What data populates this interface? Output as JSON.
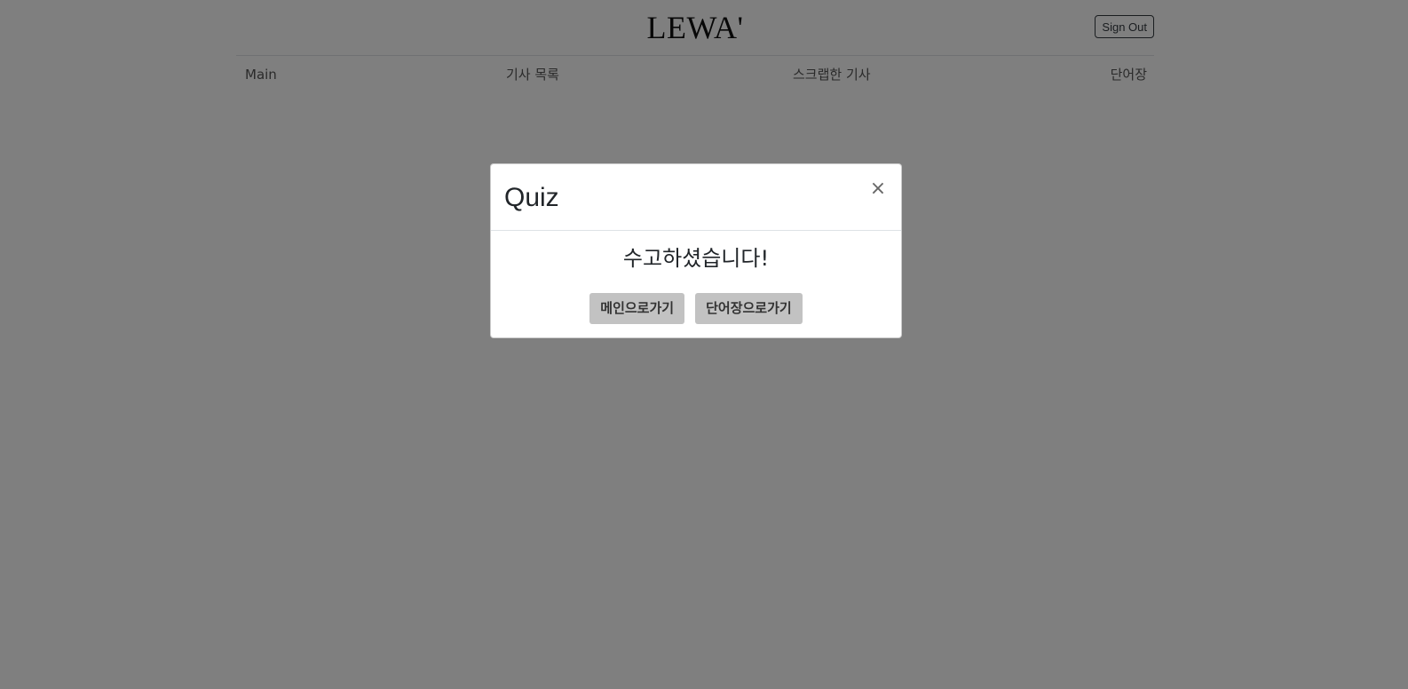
{
  "header": {
    "brand": "LEWA'",
    "sign_out_label": "Sign Out"
  },
  "nav": {
    "items": [
      {
        "label": "Main"
      },
      {
        "label": "기사 목록"
      },
      {
        "label": "스크랩한 기사"
      },
      {
        "label": "단어장"
      }
    ]
  },
  "modal": {
    "title": "Quiz",
    "close_glyph": "×",
    "message": "수고하셨습니다!",
    "buttons": [
      {
        "label": "메인으로가기"
      },
      {
        "label": "단어장으로가기"
      }
    ]
  },
  "colors": {
    "backdrop": "#808080",
    "button_bg": "#c2c2c2",
    "text": "#212529"
  },
  "icons": {
    "close": "close-icon"
  }
}
